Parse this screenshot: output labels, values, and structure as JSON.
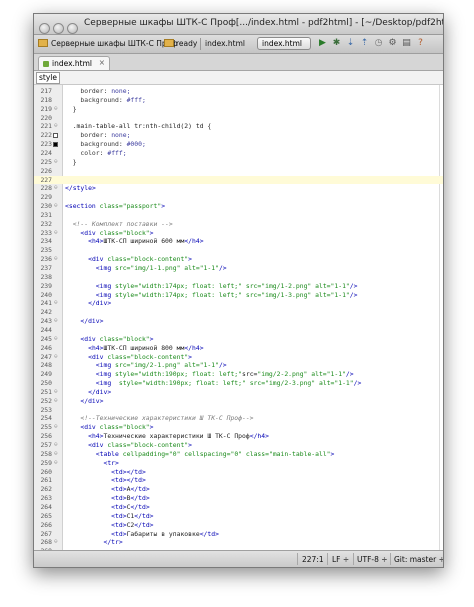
{
  "window": {
    "title": "Серверные шкафы ШТК-С Проф[.../index.html - pdf2html] - [~/Desktop/pdf2html]"
  },
  "toolbar": {
    "crumb1": "Серверные шкафы ШТК-С Проф",
    "crumb2": "ready",
    "crumb3": "index.html",
    "run_config": "index.html",
    "run_icon": "play-icon",
    "debug_icon": "bug-icon"
  },
  "tabs": [
    {
      "label": "index.html",
      "close": "×"
    }
  ],
  "breadcrumb": {
    "item": "style"
  },
  "colors": {
    "tag": "#0000b4",
    "attr": "#1a8a1a",
    "comment": "#7a7a7a",
    "current_line": "#fffbd7",
    "breakpoint_white": "#ffffff",
    "breakpoint_black": "#000000"
  },
  "editor": {
    "lines": [
      {
        "n": "217",
        "html": "    border: none;"
      },
      {
        "n": "218",
        "html": "    background: #fff;"
      },
      {
        "n": "219",
        "html": "  }"
      },
      {
        "n": "220",
        "html": ""
      },
      {
        "n": "221",
        "html": "  .main-table-all tr:nth-child(2) td {"
      },
      {
        "n": "222",
        "html": "    border: none;"
      },
      {
        "n": "223",
        "html": "    background: #000;"
      },
      {
        "n": "224",
        "html": "    color: #fff;"
      },
      {
        "n": "225",
        "html": "  }"
      },
      {
        "n": "226",
        "html": ""
      },
      {
        "n": "227",
        "html": ""
      },
      {
        "n": "228",
        "html": "</style>"
      },
      {
        "n": "229",
        "html": ""
      },
      {
        "n": "230",
        "html": "<section class=\"passport\">"
      },
      {
        "n": "231",
        "html": ""
      },
      {
        "n": "232",
        "html": "  <!-- Комплект поставки -->"
      },
      {
        "n": "233",
        "html": "    <div class=\"block\">"
      },
      {
        "n": "234",
        "html": "      <h4>ШТК-СП шириной 600 мм</h4>"
      },
      {
        "n": "235",
        "html": ""
      },
      {
        "n": "236",
        "html": "      <div class=\"block-content\">"
      },
      {
        "n": "237",
        "html": "        <img src=\"img/1-1.png\" alt=\"1-1\"/>"
      },
      {
        "n": "238",
        "html": ""
      },
      {
        "n": "239",
        "html": "        <img style=\"width:174px; float: left;\" src=\"img/1-2.png\" alt=\"1-1\"/>"
      },
      {
        "n": "240",
        "html": "        <img style=\"width:174px; float: left;\" src=\"img/1-3.png\" alt=\"1-1\"/>"
      },
      {
        "n": "241",
        "html": "      </div>"
      },
      {
        "n": "242",
        "html": ""
      },
      {
        "n": "243",
        "html": "    </div>"
      },
      {
        "n": "244",
        "html": ""
      },
      {
        "n": "245",
        "html": "    <div class=\"block\">"
      },
      {
        "n": "246",
        "html": "      <h4>ШТК-СП шириной 800 мм</h4>"
      },
      {
        "n": "247",
        "html": "      <div class=\"block-content\">"
      },
      {
        "n": "248",
        "html": "        <img src=\"img/2-1.png\" alt=\"1-1\"/>"
      },
      {
        "n": "249",
        "html": "        <img style=\"width:190px; float: left;\"src=\"img/2-2.png\" alt=\"1-1\"/>"
      },
      {
        "n": "250",
        "html": "        <img  style=\"width:190px; float: left;\" src=\"img/2-3.png\" alt=\"1-1\"/>"
      },
      {
        "n": "251",
        "html": "      </div>"
      },
      {
        "n": "252",
        "html": "    </div>"
      },
      {
        "n": "253",
        "html": ""
      },
      {
        "n": "254",
        "html": "    <!--Технические характеристики Ш ТК-С Проф-->"
      },
      {
        "n": "255",
        "html": "    <div class=\"block\">"
      },
      {
        "n": "256",
        "html": "      <h4>Технические характеристики Ш ТК-С Проф</h4>"
      },
      {
        "n": "257",
        "html": "      <div class=\"block-content\">"
      },
      {
        "n": "258",
        "html": "        <table cellpadding=\"0\" cellspacing=\"0\" class=\"main-table-all\">"
      },
      {
        "n": "259",
        "html": "          <tr>"
      },
      {
        "n": "260",
        "html": "            <td></td>"
      },
      {
        "n": "261",
        "html": "            <td></td>"
      },
      {
        "n": "262",
        "html": "            <td>A</td>"
      },
      {
        "n": "263",
        "html": "            <td>B</td>"
      },
      {
        "n": "264",
        "html": "            <td>C</td>"
      },
      {
        "n": "265",
        "html": "            <td>C1</td>"
      },
      {
        "n": "266",
        "html": "            <td>C2</td>"
      },
      {
        "n": "267",
        "html": "            <td>Габариты в упаковке</td>"
      },
      {
        "n": "268",
        "html": "          </tr>"
      },
      {
        "n": "269",
        "html": ""
      },
      {
        "n": "270",
        "html": "          <tr>"
      },
      {
        "n": "271",
        "html": "            <td>Модификация</td>"
      }
    ]
  },
  "statusbar": {
    "position": "227:1",
    "line_sep": "LF ÷",
    "encoding": "UTF-8 ÷",
    "vcs": "Git: master ÷"
  }
}
